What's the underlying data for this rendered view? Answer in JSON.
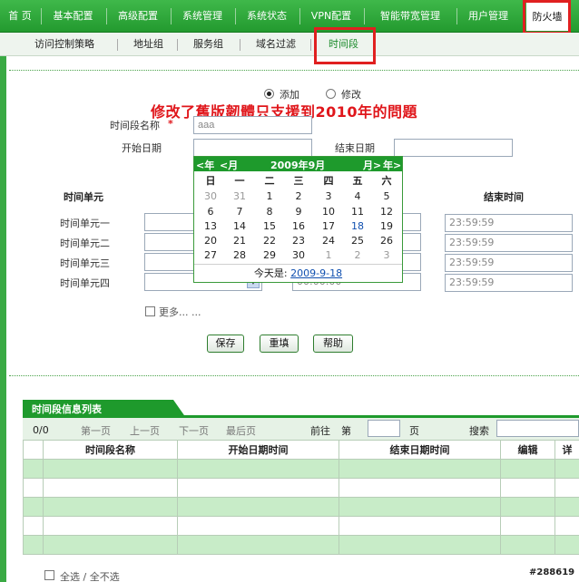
{
  "top_nav": {
    "items": [
      "首 页",
      "基本配置",
      "高级配置",
      "系统管理",
      "系统状态",
      "VPN配置",
      "智能带宽管理",
      "用户管理",
      "防火墙"
    ],
    "active": "防火墙"
  },
  "sub_nav": {
    "items": [
      "访问控制策略",
      "地址组",
      "服务组",
      "域名过滤",
      "时间段"
    ],
    "active": "时间段"
  },
  "annotation": "修改了舊版韌體只支援到2010年的問題",
  "mode": {
    "add_label": "添加",
    "edit_label": "修改",
    "selected": "添加"
  },
  "form": {
    "name_label": "时间段名称",
    "required_mark": "*",
    "name_value": "aaa",
    "start_date_label": "开始日期",
    "end_date_label": "结束日期"
  },
  "time_units": {
    "header_unit": "时间单元",
    "header_end": "结束时间",
    "units": [
      {
        "label": "时间单元一",
        "end": "23:59:59"
      },
      {
        "label": "时间单元二",
        "end": "23:59:59"
      },
      {
        "label": "时间单元三",
        "end": "23:59:59"
      },
      {
        "label": "时间单元四",
        "end": "23:59:59"
      }
    ],
    "unit4_start_placeholder": "00:00:00",
    "more_label": "更多... ..."
  },
  "calendar": {
    "prev_year": "<年",
    "prev_month": "<月",
    "title": "2009年9月",
    "next_month": "月>",
    "next_year": "年>",
    "weekdays": [
      "日",
      "一",
      "二",
      "三",
      "四",
      "五",
      "六"
    ],
    "weeks": [
      [
        "30",
        "31",
        "1",
        "2",
        "3",
        "4",
        "5"
      ],
      [
        "6",
        "7",
        "8",
        "9",
        "10",
        "11",
        "12"
      ],
      [
        "13",
        "14",
        "15",
        "16",
        "17",
        "18",
        "19"
      ],
      [
        "20",
        "21",
        "22",
        "23",
        "24",
        "25",
        "26"
      ],
      [
        "27",
        "28",
        "29",
        "30",
        "1",
        "2",
        "3"
      ]
    ],
    "today_label": "今天是:",
    "today_value": "2009-9-18"
  },
  "buttons": {
    "save": "保存",
    "reset": "重填",
    "help": "帮助"
  },
  "list": {
    "title": "时间段信息列表",
    "count": "0/0",
    "first": "第一页",
    "prev": "上一页",
    "next": "下一页",
    "last": "最后页",
    "goto_label": "前往",
    "page_prefix": "第",
    "page_suffix": "页",
    "search_label": "搜索",
    "columns": [
      "",
      "时间段名称",
      "开始日期时间",
      "结束日期时间",
      "编辑",
      "详"
    ],
    "select_all": "全选 / 全不选"
  },
  "watermark": "#288619"
}
